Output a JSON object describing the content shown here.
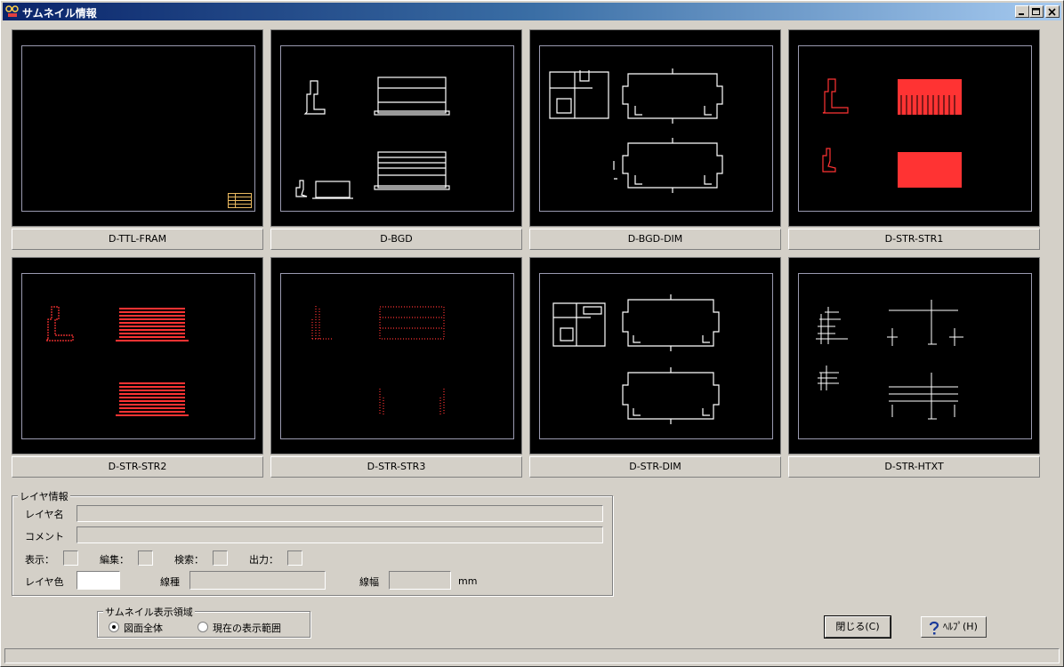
{
  "window": {
    "title": "サムネイル情報"
  },
  "thumbnails": [
    {
      "label": "D-TTL-FRAM",
      "color": "#ffffff"
    },
    {
      "label": "D-BGD",
      "color": "#ffffff"
    },
    {
      "label": "D-BGD-DIM",
      "color": "#ffffff"
    },
    {
      "label": "D-STR-STR1",
      "color": "#ff3333"
    },
    {
      "label": "D-STR-STR2",
      "color": "#ff3333"
    },
    {
      "label": "D-STR-STR3",
      "color": "#ff3333"
    },
    {
      "label": "D-STR-DIM",
      "color": "#ffffff"
    },
    {
      "label": "D-STR-HTXT",
      "color": "#ffffff"
    }
  ],
  "layer_info": {
    "title": "レイヤ情報",
    "name_label": "レイヤ名",
    "comment_label": "コメント",
    "display_label": "表示：",
    "edit_label": "編集：",
    "search_label": "検索：",
    "output_label": "出力：",
    "color_label": "レイヤ色",
    "linetype_label": "線種",
    "linewidth_label": "線幅",
    "unit": "mm"
  },
  "thumbnail_area": {
    "title": "サムネイル表示領域",
    "options": [
      "図面全体",
      "現在の表示範囲"
    ]
  },
  "buttons": {
    "close": "閉じる(C)",
    "help": "ﾍﾙﾌﾟ(H)"
  },
  "colors": {
    "titlebar_start": "#0a246a",
    "face": "#d4d0c8",
    "red": "#ff3333",
    "title_block": "#e8b860"
  }
}
